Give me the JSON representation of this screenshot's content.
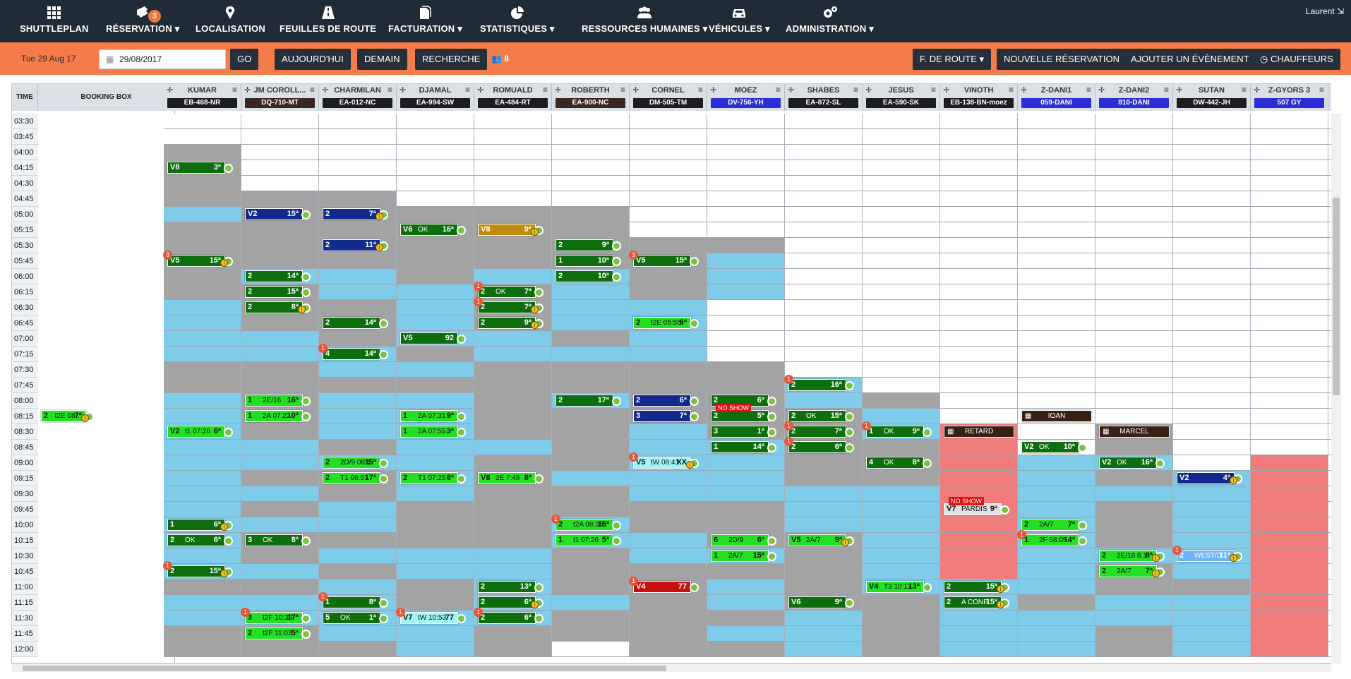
{
  "nav": {
    "brand": "SHUTTLEPLAN",
    "items": [
      {
        "label": "RÉSERVATION",
        "icon": "ticket-icon",
        "badge": "3"
      },
      {
        "label": "LOCALISATION",
        "icon": "map-marker-icon"
      },
      {
        "label": "FEUILLES DE ROUTE",
        "icon": "road-icon"
      },
      {
        "label": "FACTURATION",
        "icon": "invoice-icon"
      },
      {
        "label": "STATISTIQUES",
        "icon": "pie-chart-icon"
      },
      {
        "label": "RESSOURCES HUMAINES",
        "icon": "users-icon"
      },
      {
        "label": "VÉHICULES",
        "icon": "car-icon"
      },
      {
        "label": "ADMINISTRATION",
        "icon": "gears-icon"
      }
    ],
    "user": "Laurent",
    "colors": {
      "bar": "#1f2b36",
      "accent": "#f47b4a"
    }
  },
  "toolbar": {
    "date_label": "Tue 29 Aug 17",
    "date_value": "29/08/2017",
    "go": "GO",
    "today": "AUJOURD'HUI",
    "tomorrow": "DEMAIN",
    "search": "RECHERCHE",
    "people_count": "8",
    "route_sheet": "F. DE ROUTE",
    "new_booking": "NOUVELLE RÉSERVATION",
    "add_event": "AJOUTER UN ÉVÈNEMENT",
    "drivers": "CHAUFFEURS"
  },
  "grid": {
    "time_header": "TIME",
    "booking_box": "BOOKING BOX",
    "drivers": [
      {
        "name": "KUMAR",
        "plate": "EB-468-NR",
        "color": "#1d1d1d"
      },
      {
        "name": "JM COROLL...",
        "plate": "DQ-710-MT",
        "color": "#3b2620"
      },
      {
        "name": "CHARMILAN",
        "plate": "EA-012-NC",
        "color": "#1d1d1d"
      },
      {
        "name": "DJAMAL",
        "plate": "EA-994-SW",
        "color": "#1d1d1d"
      },
      {
        "name": "ROMUALD",
        "plate": "EA-484-RT",
        "color": "#1d1d1d"
      },
      {
        "name": "ROBERTH",
        "plate": "EA-900-NC",
        "color": "#3b2620"
      },
      {
        "name": "CORNEL",
        "plate": "DM-505-TM",
        "color": "#1d1d1d"
      },
      {
        "name": "MOEZ",
        "plate": "DV-756-YH",
        "color": "#2b2ed6"
      },
      {
        "name": "SHABES",
        "plate": "EA-872-SL",
        "color": "#1d1d1d"
      },
      {
        "name": "JESUS",
        "plate": "EA-590-SK",
        "color": "#1d1d1d"
      },
      {
        "name": "VINOTH",
        "plate": "EB-138-BN-moez",
        "color": "#1d1d1d"
      },
      {
        "name": "Z-DANI1",
        "plate": "059-DANI",
        "color": "#2b2ed6"
      },
      {
        "name": "Z-DANI2",
        "plate": "810-DANI",
        "color": "#2b2ed6"
      },
      {
        "name": "SUTAN",
        "plate": "DW-442-JH",
        "color": "#1d1d1d"
      },
      {
        "name": "Z-GYORS 3",
        "plate": "507 GY",
        "color": "#2b2ed6"
      }
    ],
    "times": [
      "03:30",
      "03:45",
      "04:00",
      "04:15",
      "04:30",
      "04:45",
      "05:00",
      "05:15",
      "05:30",
      "05:45",
      "06:00",
      "06:15",
      "06:30",
      "06:45",
      "07:00",
      "07:15",
      "07:30",
      "07:45",
      "08:00",
      "08:15",
      "08:30",
      "08:45",
      "09:00",
      "09:15",
      "09:30",
      "09:45",
      "10:00",
      "10:15",
      "10:30",
      "10:45",
      "11:00",
      "11:15",
      "11:30",
      "11:45",
      "12:00"
    ],
    "cells": [
      "wwwwwwwwwwwwwww",
      "wwwwwwwwwwwwwww",
      "gwwwwwwwwwwwwww",
      "gwwwwwwwwwwwwww",
      "gwwwwwwwwwwwwww",
      "gggwwwwwwwwwwww",
      "bgggggwwwwwwwww",
      "ggggggwwwwwwwww",
      "ggggggggwwwwwww",
      "gggggggbwwwwwww",
      "gbbgbbgbwwwwwww",
      "ggbbgbgbwwwwwww",
      "bggbgbbwwwwwwww",
      "bggbgbbwwwwwwww",
      "bbgbbgbwwwwwwww",
      "bbbgbbbwwwwwwww",
      "ggbbggggwwwwwww",
      "ggggggggbwwwwww",
      "bgbbgbggbgwwwww",
      "bgbbgggggbwwwww",
      "bgbbggbggbrwgwww",
      "bbgbbgbbggrwgww",
      "bbbbggbbggrbbwr",
      "bggbgbbbggrbgbr",
      "bbgbggbbbbrbbbr",
      "bgbgggggbbrbgbr",
      "bbbggbggbbrbgbr",
      "bggggbbggbrbgbr",
      "bgbbbgbbgbrbbbr",
      "bbgbbggggbrbgbr",
      "ggbgbggbgbbbggr",
      "bbbgbbgbggbgbbr",
      "bbbbbgggbgbbbbr",
      "ggbbgggbbgbbgbr",
      "gggbgwggbgbbgbr"
    ],
    "legend": {
      "w": "#ffffff",
      "g": "#a3a3a3",
      "b": "#7fcbea",
      "r": "#ef7b7b"
    },
    "events": [
      {
        "c": 0,
        "r": 3,
        "l": "V8",
        "m": "",
        "v": "3ª",
        "k": "dg"
      },
      {
        "c": 0,
        "r": 9,
        "l": "V5",
        "m": "",
        "v": "15ª",
        "k": "dg",
        "i": 1,
        "b": "3"
      },
      {
        "c": 0,
        "r": 20,
        "l": "V2",
        "m": "t1 07:26",
        "v": "6ª",
        "k": "lg"
      },
      {
        "c": 0,
        "r": 26,
        "l": "1",
        "m": "",
        "v": "6ª",
        "k": "dg",
        "i": 1
      },
      {
        "c": 0,
        "r": 27,
        "l": "2",
        "m": "OK",
        "v": "6ª",
        "k": "dg"
      },
      {
        "c": 0,
        "r": 29,
        "l": "2",
        "m": "",
        "v": "15ª",
        "k": "dg",
        "i": 1,
        "b": "1"
      },
      {
        "c": -1,
        "r": 19,
        "l": "2",
        "m": "t2E 08:.",
        "v": "7ª",
        "k": "lg",
        "i": 1
      },
      {
        "c": 1,
        "r": 6,
        "l": "V2",
        "m": "",
        "v": "15ª",
        "k": "nb"
      },
      {
        "c": 1,
        "r": 10,
        "l": "2",
        "m": "",
        "v": "14ª",
        "k": "dg"
      },
      {
        "c": 1,
        "r": 11,
        "l": "2",
        "m": "",
        "v": "15ª",
        "k": "dg"
      },
      {
        "c": 1,
        "r": 12,
        "l": "2",
        "m": "",
        "v": "8ª",
        "k": "dg",
        "i": 1
      },
      {
        "c": 1,
        "r": 18,
        "l": "1",
        "m": "2E/16",
        "v": "16ª",
        "k": "lg"
      },
      {
        "c": 1,
        "r": 19,
        "l": "1",
        "m": "2A 07:22",
        "v": "10ª",
        "k": "lg"
      },
      {
        "c": 1,
        "r": 27,
        "l": "3",
        "m": "OK",
        "v": "8ª",
        "k": "dg"
      },
      {
        "c": 1,
        "r": 32,
        "l": "3",
        "m": "t2F 10:39",
        "v": "17ª",
        "k": "lg",
        "b": "1"
      },
      {
        "c": 1,
        "r": 33,
        "l": "2",
        "m": "t2F 11:03",
        "v": "5ª",
        "k": "lg"
      },
      {
        "c": 2,
        "r": 6,
        "l": "2",
        "m": "",
        "v": "7ª",
        "k": "nb",
        "i": 1
      },
      {
        "c": 2,
        "r": 8,
        "l": "2",
        "m": "",
        "v": "11ª",
        "k": "nb",
        "i": 1
      },
      {
        "c": 2,
        "r": 13,
        "l": "2",
        "m": "",
        "v": "14ª",
        "k": "dg"
      },
      {
        "c": 2,
        "r": 15,
        "l": "4",
        "m": "",
        "v": "14ª",
        "k": "dg",
        "b": "1"
      },
      {
        "c": 2,
        "r": 22,
        "l": "2",
        "m": "2D/9 08:1",
        "v": "15ª",
        "k": "lg"
      },
      {
        "c": 2,
        "r": 23,
        "l": "2",
        "m": "T1 08:57",
        "v": "17ª",
        "k": "lg"
      },
      {
        "c": 2,
        "r": 31,
        "l": "1",
        "m": "",
        "v": "8ª",
        "k": "dg",
        "b": "1"
      },
      {
        "c": 2,
        "r": 32,
        "l": "5",
        "m": "OK",
        "v": "1ª",
        "k": "dg"
      },
      {
        "c": 3,
        "r": 7,
        "l": "V6",
        "m": "OK",
        "v": "16ª",
        "k": "dg"
      },
      {
        "c": 3,
        "r": 14,
        "l": "V5",
        "m": "",
        "v": "92",
        "k": "dg"
      },
      {
        "c": 3,
        "r": 19,
        "l": "1",
        "m": "2A 07:31",
        "v": "9ª",
        "k": "lg"
      },
      {
        "c": 3,
        "r": 20,
        "l": "1",
        "m": "2A 07:55",
        "v": "3ª",
        "k": "lg"
      },
      {
        "c": 3,
        "r": 23,
        "l": "2",
        "m": "T1 07:25",
        "v": "8ª",
        "k": "lg"
      },
      {
        "c": 3,
        "r": 32,
        "l": "V7",
        "m": "tW 10:53",
        "v": "77",
        "k": "cy",
        "b": "1"
      },
      {
        "c": 4,
        "r": 7,
        "l": "V8",
        "m": "",
        "v": "9ª",
        "k": "or",
        "i": 1
      },
      {
        "c": 4,
        "r": 11,
        "l": "2",
        "m": "OK",
        "v": "7ª",
        "k": "dg",
        "b": "1"
      },
      {
        "c": 4,
        "r": 12,
        "l": "2",
        "m": "",
        "v": "7ª",
        "k": "dg",
        "i": 1,
        "b": "1"
      },
      {
        "c": 4,
        "r": 13,
        "l": "2",
        "m": "",
        "v": "9ª",
        "k": "dg",
        "i": 1
      },
      {
        "c": 4,
        "r": 23,
        "l": "V8",
        "m": "2E 7:48",
        "v": "8ª",
        "k": "lg"
      },
      {
        "c": 4,
        "r": 30,
        "l": "2",
        "m": "",
        "v": "13ª",
        "k": "dg"
      },
      {
        "c": 4,
        "r": 31,
        "l": "2",
        "m": "",
        "v": "6ª",
        "k": "dg",
        "i": 1
      },
      {
        "c": 4,
        "r": 32,
        "l": "2",
        "m": "",
        "v": "6ª",
        "k": "dg",
        "b": "1"
      },
      {
        "c": 5,
        "r": 8,
        "l": "2",
        "m": "",
        "v": "9ª",
        "k": "dg"
      },
      {
        "c": 5,
        "r": 9,
        "l": "1",
        "m": "",
        "v": "10ª",
        "k": "dg"
      },
      {
        "c": 5,
        "r": 10,
        "l": "2",
        "m": "",
        "v": "10ª",
        "k": "dg"
      },
      {
        "c": 5,
        "r": 18,
        "l": "2",
        "m": "",
        "v": "17ª",
        "k": "dg"
      },
      {
        "c": 5,
        "r": 26,
        "l": "2",
        "m": "t2A 08:35",
        "v": "15ª",
        "k": "lg",
        "b": "1"
      },
      {
        "c": 5,
        "r": 27,
        "l": "1",
        "m": "t1 07:26",
        "v": "5ª",
        "k": "lg"
      },
      {
        "c": 6,
        "r": 9,
        "l": "V5",
        "m": "",
        "v": "15ª",
        "k": "dg",
        "b": "3"
      },
      {
        "c": 6,
        "r": 13,
        "l": "2",
        "m": "t2E 05:55",
        "v": "6ª",
        "k": "lg"
      },
      {
        "c": 6,
        "r": 18,
        "l": "2",
        "m": "",
        "v": "6ª",
        "k": "nb"
      },
      {
        "c": 6,
        "r": 19,
        "l": "3",
        "m": "",
        "v": "7ª",
        "k": "nb"
      },
      {
        "c": 6,
        "r": 22,
        "l": "V5",
        "m": "tW 08:41",
        "v": "XX",
        "k": "cy",
        "i": 1,
        "b": "1"
      },
      {
        "c": 6,
        "r": 30,
        "l": "V4",
        "m": "",
        "v": "77",
        "k": "rd",
        "b": "1"
      },
      {
        "c": 7,
        "r": 18,
        "l": "2",
        "m": "",
        "v": "6ª",
        "k": "dg"
      },
      {
        "c": 7,
        "r": 19,
        "l": "2",
        "m": "",
        "v": "5ª",
        "k": "dg",
        "ns": "NO SHOW"
      },
      {
        "c": 7,
        "r": 20,
        "l": "3",
        "m": "",
        "v": "1ª",
        "k": "dg"
      },
      {
        "c": 7,
        "r": 21,
        "l": "1",
        "m": "",
        "v": "14ª",
        "k": "dg"
      },
      {
        "c": 7,
        "r": 27,
        "l": "6",
        "m": "2D/9",
        "v": "6ª",
        "k": "lg"
      },
      {
        "c": 7,
        "r": 28,
        "l": "1",
        "m": "2A/7",
        "v": "15ª",
        "k": "lg"
      },
      {
        "c": 8,
        "r": 17,
        "l": "2",
        "m": "",
        "v": "16ª",
        "k": "dg",
        "b": "1"
      },
      {
        "c": 8,
        "r": 19,
        "l": "2",
        "m": "OK",
        "v": "15ª",
        "k": "dg"
      },
      {
        "c": 8,
        "r": 20,
        "l": "2",
        "m": "",
        "v": "7ª",
        "k": "dg",
        "b": "1"
      },
      {
        "c": 8,
        "r": 21,
        "l": "2",
        "m": "",
        "v": "6ª",
        "k": "dg",
        "b": "1"
      },
      {
        "c": 8,
        "r": 27,
        "l": "V5",
        "m": "2A/7",
        "v": "9ª",
        "k": "lg",
        "i": 1
      },
      {
        "c": 8,
        "r": 31,
        "l": "V6",
        "m": "",
        "v": "9ª",
        "k": "dg"
      },
      {
        "c": 9,
        "r": 20,
        "l": "1",
        "m": "OK",
        "v": "9ª",
        "k": "dg",
        "b": "1"
      },
      {
        "c": 9,
        "r": 22,
        "l": "4",
        "m": "OK",
        "v": "8ª",
        "k": "dg"
      },
      {
        "c": 9,
        "r": 30,
        "l": "V4",
        "m": "T3 10:17",
        "v": "13ª",
        "k": "lg"
      },
      {
        "c": 10,
        "r": 20,
        "l": "",
        "m": "RETARD",
        "v": "",
        "k": "br"
      },
      {
        "c": 10,
        "r": 25,
        "l": "V7",
        "m": "PARDIS",
        "v": "9ª",
        "k": "gy",
        "ns": "NO SHOW"
      },
      {
        "c": 10,
        "r": 30,
        "l": "2",
        "m": "",
        "v": "15ª",
        "k": "dg",
        "i": 1
      },
      {
        "c": 10,
        "r": 31,
        "l": "2",
        "m": "A CONF",
        "v": "15ª",
        "k": "dg",
        "i": 1
      },
      {
        "c": 11,
        "r": 19,
        "l": "",
        "m": "IOAN",
        "v": "",
        "k": "br"
      },
      {
        "c": 11,
        "r": 21,
        "l": "V2",
        "m": "OK",
        "v": "10ª",
        "k": "dg"
      },
      {
        "c": 11,
        "r": 26,
        "l": "2",
        "m": "2A/7",
        "v": "7ª",
        "k": "lg"
      },
      {
        "c": 11,
        "r": 27,
        "l": "1",
        "m": "2F 08:05",
        "v": "14ª",
        "k": "lg",
        "b": "1"
      },
      {
        "c": 12,
        "r": 20,
        "l": "",
        "m": "MARCEL",
        "v": "",
        "k": "br"
      },
      {
        "c": 12,
        "r": 22,
        "l": "V2",
        "m": "OK",
        "v": "16ª",
        "k": "dg"
      },
      {
        "c": 12,
        "r": 28,
        "l": "2",
        "m": "2E/18 8.1",
        "v": "8ª",
        "k": "lg",
        "i": 1
      },
      {
        "c": 12,
        "r": 29,
        "l": "2",
        "m": "2A/7",
        "v": "7ª",
        "k": "lg",
        "i": 1
      },
      {
        "c": 13,
        "r": 23,
        "l": "V2",
        "m": "",
        "v": "4ª",
        "k": "nb",
        "i": 1
      },
      {
        "c": 13,
        "r": 28,
        "l": "2",
        "m": "WEST/D",
        "v": "11ª",
        "k": "sb",
        "i": 1,
        "b": "1"
      }
    ]
  }
}
